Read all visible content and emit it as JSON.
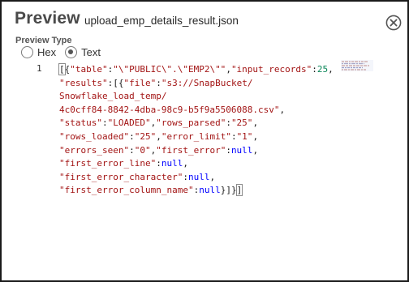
{
  "dialog": {
    "title": "Preview",
    "filename": "upload_emp_details_result.json",
    "close_icon": "close-circle-icon"
  },
  "preview_type": {
    "label": "Preview Type",
    "options": [
      {
        "label": "Hex",
        "selected": false
      },
      {
        "label": "Text",
        "selected": true
      }
    ]
  },
  "code": {
    "line_number": "1",
    "tokens": {
      "k_table": "\"table\"",
      "v_table": "\"\\\"PUBLIC\\\".\\\"EMP2\\\"\"",
      "k_input_records": "\"input_records\"",
      "v_input_records": "25",
      "k_results": "\"results\"",
      "k_file": "\"file\"",
      "v_file_1": "\"s3://SnapBucket/",
      "v_file_2": "Snowflake_load_temp/",
      "v_file_3": "4c0cff84-8842-4dba-98c9-b5f9a5506088.csv\"",
      "k_status": "\"status\"",
      "v_status": "\"LOADED\"",
      "k_rows_parsed": "\"rows_parsed\"",
      "v_rows_parsed": "\"25\"",
      "k_rows_loaded": "\"rows_loaded\"",
      "v_rows_loaded": "\"25\"",
      "k_error_limit": "\"error_limit\"",
      "v_error_limit": "\"1\"",
      "k_errors_seen": "\"errors_seen\"",
      "v_errors_seen": "\"0\"",
      "k_first_error": "\"first_error\"",
      "v_null": "null",
      "k_first_error_line": "\"first_error_line\"",
      "k_first_error_character": "\"first_error_character\"",
      "k_first_error_column_name": "\"first_error_column_name\""
    }
  },
  "colors": {
    "key": "#a31515",
    "number": "#098658",
    "keyword": "#0000ff"
  }
}
